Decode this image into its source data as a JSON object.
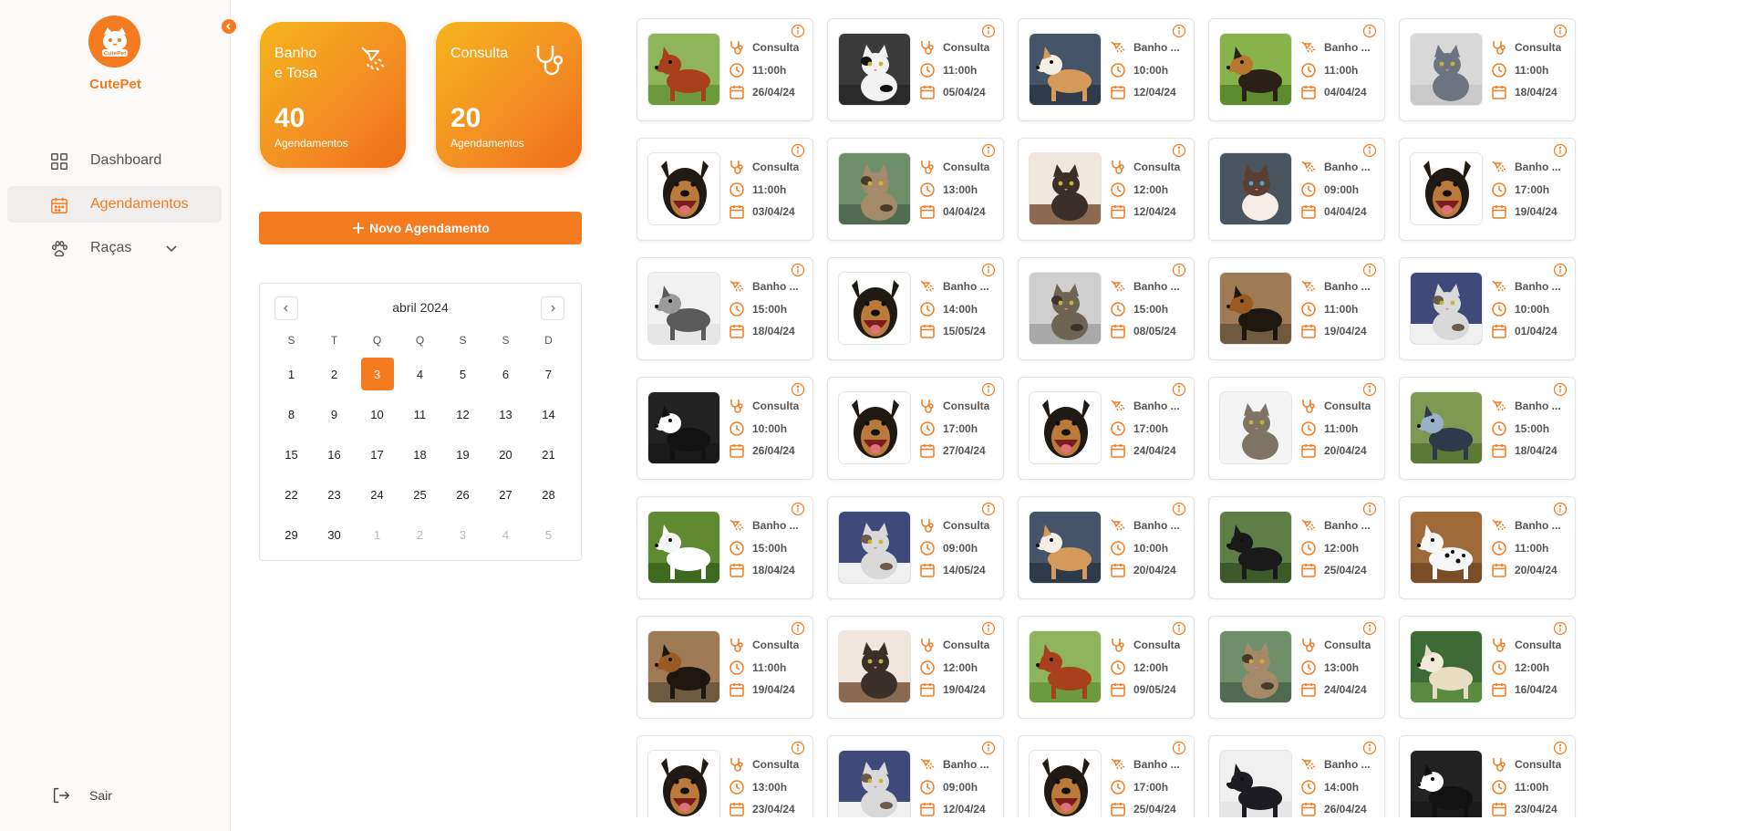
{
  "app": {
    "name": "CutePet",
    "logo_text": "CutePet"
  },
  "colors": {
    "accent": "#f47b20",
    "card_gradient_start": "#f5b41d",
    "card_gradient_end": "#ef6d1a"
  },
  "sidebar": {
    "items": [
      {
        "label": "Dashboard",
        "icon": "grid-icon"
      },
      {
        "label": "Agendamentos",
        "icon": "calendar-icon",
        "active": true
      },
      {
        "label": "Raças",
        "icon": "paw-icon",
        "has_submenu": true
      }
    ],
    "logout_label": "Sair"
  },
  "stats": [
    {
      "title": "Banho e Tosa",
      "title_line1": "Banho",
      "title_line2": "e Tosa",
      "count": "40",
      "subtitle": "Agendamentos",
      "icon": "shower-icon"
    },
    {
      "title": "Consulta",
      "count": "20",
      "subtitle": "Agendamentos",
      "icon": "stethoscope-icon"
    }
  ],
  "new_button_label": "Novo Agendamento",
  "calendar": {
    "month_label": "abril 2024",
    "weekdays": [
      "S",
      "T",
      "Q",
      "Q",
      "S",
      "S",
      "D"
    ],
    "days": [
      "1",
      "2",
      "3",
      "4",
      "5",
      "6",
      "7",
      "8",
      "9",
      "10",
      "11",
      "12",
      "13",
      "14",
      "15",
      "16",
      "17",
      "18",
      "19",
      "20",
      "21",
      "22",
      "23",
      "24",
      "25",
      "26",
      "27",
      "28",
      "29",
      "30",
      "1",
      "2",
      "3",
      "4",
      "5"
    ],
    "selected_day": "3"
  },
  "appointments": [
    {
      "type": "Consulta",
      "time": "11:00h",
      "date": "26/04/24",
      "pet": "red-setter-dog"
    },
    {
      "type": "Consulta",
      "time": "11:00h",
      "date": "05/04/24",
      "pet": "black-white-cat"
    },
    {
      "type": "Banho ...",
      "time": "10:00h",
      "date": "12/04/24",
      "pet": "akita-dog"
    },
    {
      "type": "Banho ...",
      "time": "11:00h",
      "date": "04/04/24",
      "pet": "german-shepherd-dog"
    },
    {
      "type": "Consulta",
      "time": "11:00h",
      "date": "18/04/24",
      "pet": "gray-cat"
    },
    {
      "type": "Consulta",
      "time": "11:00h",
      "date": "03/04/24",
      "pet": "smiling-dog"
    },
    {
      "type": "Consulta",
      "time": "13:00h",
      "date": "04/04/24",
      "pet": "bengal-cat"
    },
    {
      "type": "Consulta",
      "time": "12:00h",
      "date": "12/04/24",
      "pet": "siamese-cat"
    },
    {
      "type": "Banho ...",
      "time": "09:00h",
      "date": "04/04/24",
      "pet": "siamese-cat-closeup"
    },
    {
      "type": "Banho ...",
      "time": "17:00h",
      "date": "19/04/24",
      "pet": "smiling-dog"
    },
    {
      "type": "Banho ...",
      "time": "15:00h",
      "date": "18/04/24",
      "pet": "fluffy-dog-snow"
    },
    {
      "type": "Banho ...",
      "time": "14:00h",
      "date": "15/05/24",
      "pet": "smiling-dog"
    },
    {
      "type": "Banho ...",
      "time": "15:00h",
      "date": "08/05/24",
      "pet": "tabby-cat"
    },
    {
      "type": "Banho ...",
      "time": "11:00h",
      "date": "19/04/24",
      "pet": "pinscher-dog"
    },
    {
      "type": "Banho ...",
      "time": "10:00h",
      "date": "01/04/24",
      "pet": "cat-snow"
    },
    {
      "type": "Consulta",
      "time": "10:00h",
      "date": "26/04/24",
      "pet": "border-collie-dog"
    },
    {
      "type": "Consulta",
      "time": "17:00h",
      "date": "27/04/24",
      "pet": "smiling-dog"
    },
    {
      "type": "Banho ...",
      "time": "17:00h",
      "date": "24/04/24",
      "pet": "smiling-dog"
    },
    {
      "type": "Consulta",
      "time": "11:00h",
      "date": "20/04/24",
      "pet": "sitting-cat"
    },
    {
      "type": "Banho ...",
      "time": "15:00h",
      "date": "18/04/24",
      "pet": "cattle-dog"
    },
    {
      "type": "Banho ...",
      "time": "15:00h",
      "date": "18/04/24",
      "pet": "samoyed-dog"
    },
    {
      "type": "Consulta",
      "time": "09:00h",
      "date": "14/05/24",
      "pet": "cat-snow"
    },
    {
      "type": "Banho ...",
      "time": "10:00h",
      "date": "20/04/24",
      "pet": "akita-dog"
    },
    {
      "type": "Banho ...",
      "time": "12:00h",
      "date": "25/04/24",
      "pet": "black-terrier-dog"
    },
    {
      "type": "Banho ...",
      "time": "11:00h",
      "date": "20/04/24",
      "pet": "dalmatian-dog"
    },
    {
      "type": "Consulta",
      "time": "11:00h",
      "date": "19/04/24",
      "pet": "pinscher-dog"
    },
    {
      "type": "Consulta",
      "time": "12:00h",
      "date": "19/04/24",
      "pet": "siamese-cat"
    },
    {
      "type": "Consulta",
      "time": "12:00h",
      "date": "09/05/24",
      "pet": "red-setter-dog"
    },
    {
      "type": "Consulta",
      "time": "13:00h",
      "date": "24/04/24",
      "pet": "bengal-cat"
    },
    {
      "type": "Consulta",
      "time": "12:00h",
      "date": "16/04/24",
      "pet": "afghan-hound-dog"
    },
    {
      "type": "Consulta",
      "time": "13:00h",
      "date": "23/04/24",
      "pet": "smiling-dog"
    },
    {
      "type": "Banho ...",
      "time": "09:00h",
      "date": "12/04/24",
      "pet": "cat-snow"
    },
    {
      "type": "Banho ...",
      "time": "17:00h",
      "date": "25/04/24",
      "pet": "smiling-dog"
    },
    {
      "type": "Banho ...",
      "time": "14:00h",
      "date": "26/04/24",
      "pet": "curly-black-dog"
    },
    {
      "type": "Consulta",
      "time": "11:00h",
      "date": "23/04/24",
      "pet": "border-collie-dog"
    }
  ]
}
